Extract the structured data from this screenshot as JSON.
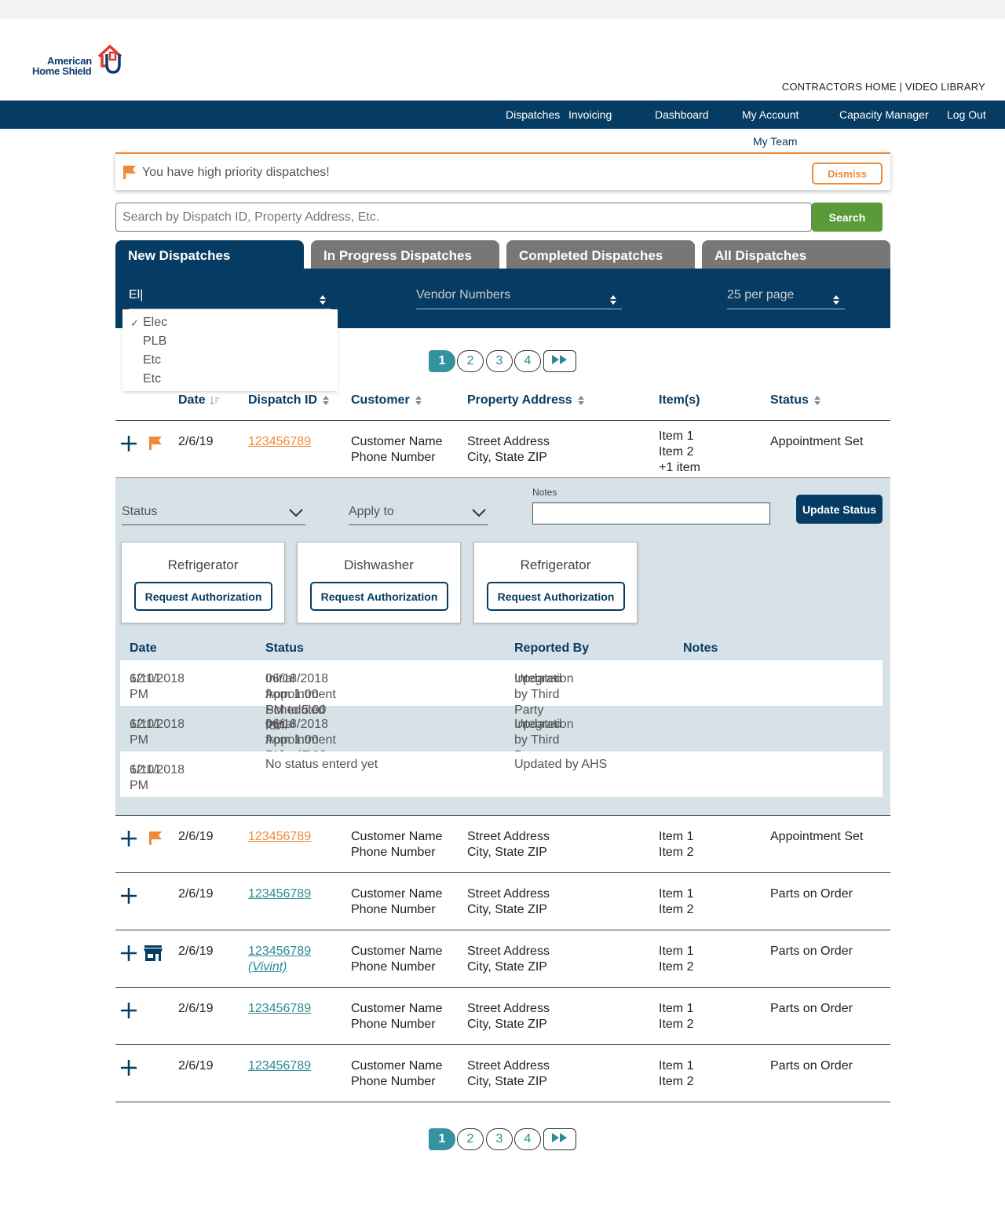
{
  "brand": {
    "line1": "American",
    "line2": "Home Shield"
  },
  "toplinks": "CONTRACTORS HOME | VIDEO LIBRARY",
  "nav": {
    "dispatches": "Dispatches",
    "invoicing": "Invoicing",
    "dashboard": "Dashboard",
    "my_account": "My Account",
    "capacity_manager": "Capacity Manager",
    "log_out": "Log Out",
    "my_team": "My Team"
  },
  "alert": {
    "message": "You have high priority dispatches!",
    "dismiss": "Dismiss"
  },
  "search": {
    "placeholder": "Search by Dispatch ID, Property Address, Etc.",
    "button": "Search"
  },
  "tabs": [
    "New Dispatches",
    "In Progress Dispatches",
    "Completed Dispatches",
    "All Dispatches"
  ],
  "filters": {
    "trade_value": "El",
    "vendor_placeholder": "Vendor Numbers",
    "per_page": "25 per page",
    "options": [
      "Elec",
      "PLB",
      "Etc",
      "Etc"
    ]
  },
  "pagination": [
    "1",
    "2",
    "3",
    "4"
  ],
  "columns": {
    "date": "Date",
    "dispatch_id": "Dispatch ID",
    "customer": "Customer",
    "property_address": "Property Address",
    "items": "Item(s)",
    "status": "Status"
  },
  "rows": [
    {
      "date": "2/6/19",
      "id": "123456789",
      "vendor": "",
      "customer_name": "Customer Name",
      "customer_phone": "Phone Number",
      "street": "Street Address",
      "city": "City, State ZIP",
      "item1": "Item 1",
      "item2": "Item 2",
      "item_more": "+1 item",
      "status": "Appointment Set"
    },
    {
      "date": "2/6/19",
      "id": "123456789",
      "vendor": "",
      "customer_name": "Customer Name",
      "customer_phone": "Phone Number",
      "street": "Street Address",
      "city": "City, State ZIP",
      "item1": "Item 1",
      "item2": "Item 2",
      "item_more": "",
      "status": "Appointment Set"
    },
    {
      "date": "2/6/19",
      "id": "123456789",
      "vendor": "",
      "customer_name": "Customer Name",
      "customer_phone": "Phone Number",
      "street": "Street Address",
      "city": "City, State ZIP",
      "item1": "Item 1",
      "item2": "Item 2",
      "item_more": "",
      "status": "Parts on Order"
    },
    {
      "date": "2/6/19",
      "id": "123456789",
      "vendor": "(Vivint)",
      "customer_name": "Customer Name",
      "customer_phone": "Phone Number",
      "street": "Street Address",
      "city": "City, State ZIP",
      "item1": "Item 1",
      "item2": "Item 2",
      "item_more": "",
      "status": "Parts on Order"
    },
    {
      "date": "2/6/19",
      "id": "123456789",
      "vendor": "",
      "customer_name": "Customer Name",
      "customer_phone": "Phone Number",
      "street": "Street Address",
      "city": "City, State ZIP",
      "item1": "Item 1",
      "item2": "Item 2",
      "item_more": "",
      "status": "Parts on Order"
    },
    {
      "date": "2/6/19",
      "id": "123456789",
      "vendor": "",
      "customer_name": "Customer Name",
      "customer_phone": "Phone Number",
      "street": "Street Address",
      "city": "City, State ZIP",
      "item1": "Item 1",
      "item2": "Item 2",
      "item_more": "",
      "status": "Parts on Order"
    }
  ],
  "expand": {
    "status_label": "Status",
    "apply_to_label": "Apply to",
    "notes_label": "Notes",
    "update_button": "Update Status",
    "cards": [
      {
        "title": "Refrigerator",
        "button": "Request Authorization"
      },
      {
        "title": "Dishwasher",
        "button": "Request Authorization"
      },
      {
        "title": "Refrigerator",
        "button": "Request Authorization"
      }
    ],
    "history_columns": {
      "date": "Date",
      "status": "Status",
      "reported_by": "Reported By",
      "notes": "Notes"
    },
    "history": [
      {
        "date": "6/11/2018",
        "time": "12:01 PM",
        "status1": "Initial Appointment Scheduled for",
        "status2": "06/18/2018 from 1:00 PM to 5:00 PM.",
        "rep1": "Updated by Third Party",
        "rep2": "Integration"
      },
      {
        "date": "6/11/2018",
        "time": "12:01 PM",
        "status1": "Initial Appointment Scheduled for",
        "status2": "06/18/2018 from 1:00 PM to 5:00 PM.",
        "rep1": "Updated by Third Party",
        "rep2": "Integration"
      },
      {
        "date": "6/11/2018",
        "time": "12:01 PM",
        "status1": "No status enterd yet",
        "status2": "",
        "rep1": "Updated by AHS",
        "rep2": ""
      }
    ]
  },
  "colors": {
    "navy": "#063c63",
    "orange": "#f08a36",
    "teal": "#2c8a95",
    "green": "#5a9a3a",
    "gray_tab": "#777777"
  },
  "icons": {
    "expand": "plus-icon",
    "priority": "flag-icon",
    "vendor": "storefront-icon",
    "sort": "sort-arrows-icon",
    "next": "fast-forward-icon"
  }
}
